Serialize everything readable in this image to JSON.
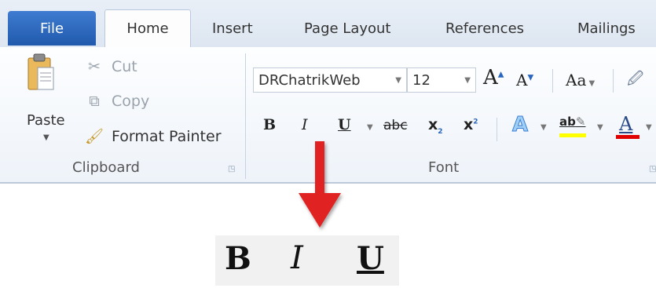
{
  "tabs": [
    {
      "label": "File"
    },
    {
      "label": "Home"
    },
    {
      "label": "Insert"
    },
    {
      "label": "Page Layout"
    },
    {
      "label": "References"
    },
    {
      "label": "Mailings"
    }
  ],
  "clipboard": {
    "paste_label": "Paste",
    "cut_label": "Cut",
    "copy_label": "Copy",
    "format_painter_label": "Format Painter",
    "group_label": "Clipboard"
  },
  "font": {
    "font_name": "DRChatrikWeb",
    "font_size": "12",
    "group_label": "Font",
    "grow_label": "A",
    "shrink_label": "A",
    "change_case_label": "Aa",
    "bold_label": "B",
    "italic_label": "I",
    "underline_label": "U",
    "strike_label": "abc",
    "subscript_label": "x",
    "superscript_label": "x",
    "text_effects_label": "A",
    "highlight_label": "ab",
    "font_color_label": "A"
  },
  "zoom": {
    "bold": "B",
    "italic": "I",
    "underline": "U"
  },
  "colors": {
    "accent_arrow": "#e02020",
    "file_tab": "#2a66bf",
    "highlight_bar": "#ffff00",
    "font_color_bar": "#e00000"
  }
}
